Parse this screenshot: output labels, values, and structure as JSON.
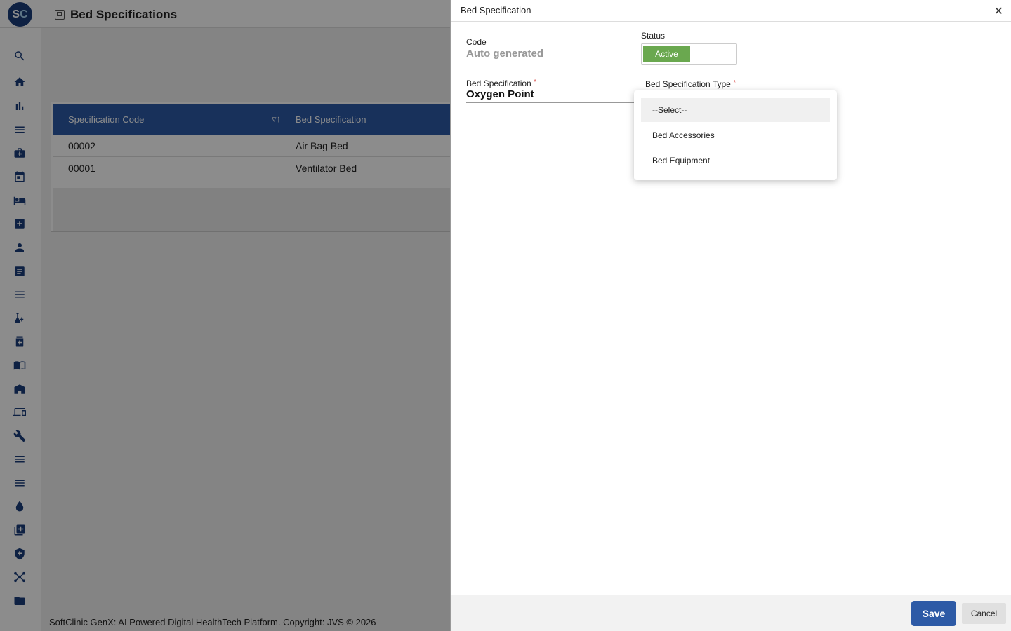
{
  "app": {
    "logo_letters": [
      "S",
      "C"
    ],
    "page_title": "Bed Specifications",
    "footer": "SoftClinic GenX: AI Powered Digital HealthTech Platform. Copyright: JVS © 2026"
  },
  "sidebar": {
    "icons": [
      "search-icon",
      "home-icon",
      "bar-chart-icon",
      "menu-icon",
      "medical-bag-icon",
      "calendar-icon",
      "bed-icon",
      "medical-plus-icon",
      "person-icon",
      "document-icon",
      "list-icon",
      "lab-icon",
      "pharmacy-icon",
      "book-icon",
      "building-icon",
      "devices-icon",
      "wrench-icon",
      "list-icon-2",
      "list-icon-3",
      "drop-icon",
      "add-box-icon",
      "shield-icon",
      "hub-icon",
      "folder-icon"
    ]
  },
  "grid": {
    "columns": [
      "Specification Code",
      "Bed Specification"
    ],
    "rows": [
      {
        "code": "00002",
        "spec": "Air Bag Bed"
      },
      {
        "code": "00001",
        "spec": "Ventilator Bed"
      }
    ]
  },
  "modal": {
    "title": "Bed Specification",
    "code_label": "Code",
    "code_value": "Auto generated",
    "status_label": "Status",
    "status_value": "Active",
    "bed_spec_label": "Bed Specification",
    "bed_spec_value": "Oxygen Point",
    "bed_spec_type_label": "Bed Specification Type",
    "required_mark": "*",
    "type_options": [
      "--Select--",
      "Bed Accessories",
      "Bed Equipment"
    ],
    "save_label": "Save",
    "cancel_label": "Cancel"
  },
  "colors": {
    "brand_blue": "#2d5aa6",
    "active_green": "#6aa84f",
    "required_red": "#d9534f"
  }
}
